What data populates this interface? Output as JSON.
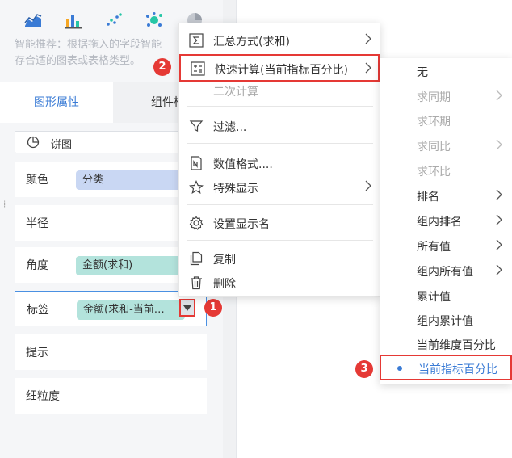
{
  "left_panel": {
    "chart_icons": [
      "area-chart-icon",
      "bar-chart-icon",
      "scatter-chart-icon",
      "bubble-chart-icon",
      "pie-chart-icon"
    ],
    "recommend_line1": "智能推荐：根据拖入的字段智能",
    "recommend_line2": "存合适的图表或表格类型。",
    "tabs": [
      {
        "label": "图形属性",
        "active": true
      },
      {
        "label": "组件样",
        "active": false
      }
    ],
    "chart_type": "饼图",
    "properties": [
      {
        "name": "颜色",
        "field": "分类"
      },
      {
        "name": "半径",
        "field": ""
      },
      {
        "name": "角度",
        "field": "金额(求和)"
      },
      {
        "name": "标签",
        "field": "金额(求和-当前…"
      },
      {
        "name": "提示",
        "field": ""
      },
      {
        "name": "细粒度",
        "field": ""
      }
    ]
  },
  "badges": [
    "1",
    "2",
    "3"
  ],
  "context_menu": {
    "items": [
      {
        "label": "汇总方式(求和)",
        "icon": "sigma-icon",
        "submenu": true
      },
      {
        "label": "快速计算(当前指标百分比)",
        "icon": "calculator-icon",
        "submenu": true
      },
      {
        "label": "二次计算",
        "icon": "",
        "disabled": true
      },
      {
        "label": "过滤...",
        "icon": "filter-icon"
      },
      {
        "label": "数值格式....",
        "icon": "number-format-icon"
      },
      {
        "label": "特殊显示",
        "icon": "star-icon",
        "submenu": true
      },
      {
        "label": "设置显示名",
        "icon": "gear-icon"
      },
      {
        "label": "复制",
        "icon": "copy-icon"
      },
      {
        "label": "删除",
        "icon": "trash-icon"
      }
    ]
  },
  "quick_calc_submenu": {
    "items": [
      {
        "label": "无",
        "disabled": false
      },
      {
        "label": "求同期",
        "disabled": true,
        "submenu": true
      },
      {
        "label": "求环期",
        "disabled": true
      },
      {
        "label": "求同比",
        "disabled": true,
        "submenu": true
      },
      {
        "label": "求环比",
        "disabled": true
      },
      {
        "label": "排名",
        "submenu": true
      },
      {
        "label": "组内排名",
        "submenu": true
      },
      {
        "label": "所有值",
        "submenu": true
      },
      {
        "label": "组内所有值",
        "submenu": true
      },
      {
        "label": "累计值"
      },
      {
        "label": "组内累计值"
      },
      {
        "label": "当前维度百分比"
      },
      {
        "label": "当前指标百分比",
        "selected": true
      }
    ]
  },
  "colors": {
    "accent": "#3a7bd5",
    "highlight_red": "#e53935",
    "pill_blue": "#c9d7f3",
    "pill_teal": "#b3e3dc"
  }
}
